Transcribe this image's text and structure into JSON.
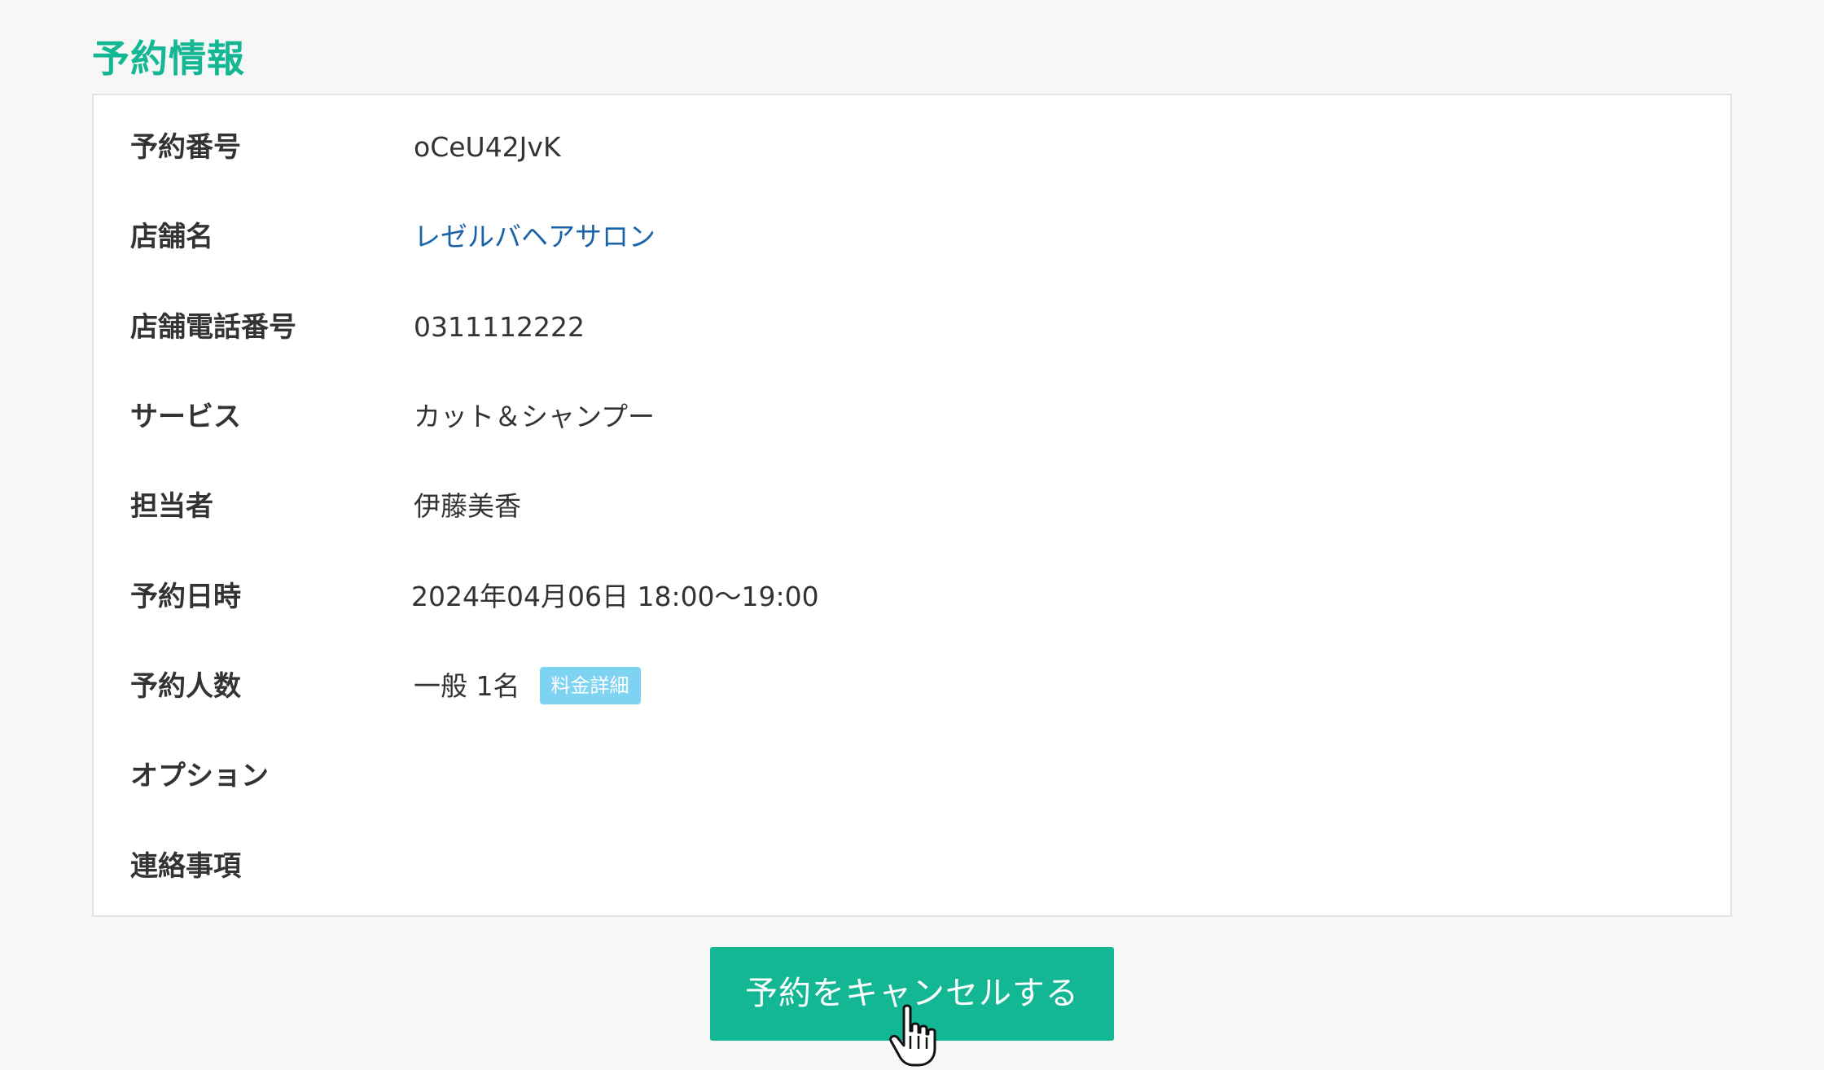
{
  "section": {
    "title": "予約情報"
  },
  "reservation": {
    "rows": [
      {
        "label": "予約番号",
        "value": "oCeU42JvK"
      },
      {
        "label": "店舗名",
        "value": "レゼルバヘアサロン"
      },
      {
        "label": "店舗電話番号",
        "value": "0311112222"
      },
      {
        "label": "サービス",
        "value": "カット＆シャンプー"
      },
      {
        "label": "担当者",
        "value": "伊藤美香"
      },
      {
        "label": "予約日時",
        "value": "2024年04月06日 18:00〜19:00"
      },
      {
        "label": "予約人数",
        "value": "一般 1名",
        "badge": "料金詳細"
      },
      {
        "label": "オプション",
        "value": ""
      },
      {
        "label": "連絡事項",
        "value": ""
      }
    ]
  },
  "actions": {
    "cancel_label": "予約をキャンセルする"
  },
  "icons": {
    "cursor": "hand-pointer-icon"
  },
  "colors": {
    "accent": "#13b794",
    "link": "#1a63a8",
    "badge": "#7fd3f2"
  }
}
